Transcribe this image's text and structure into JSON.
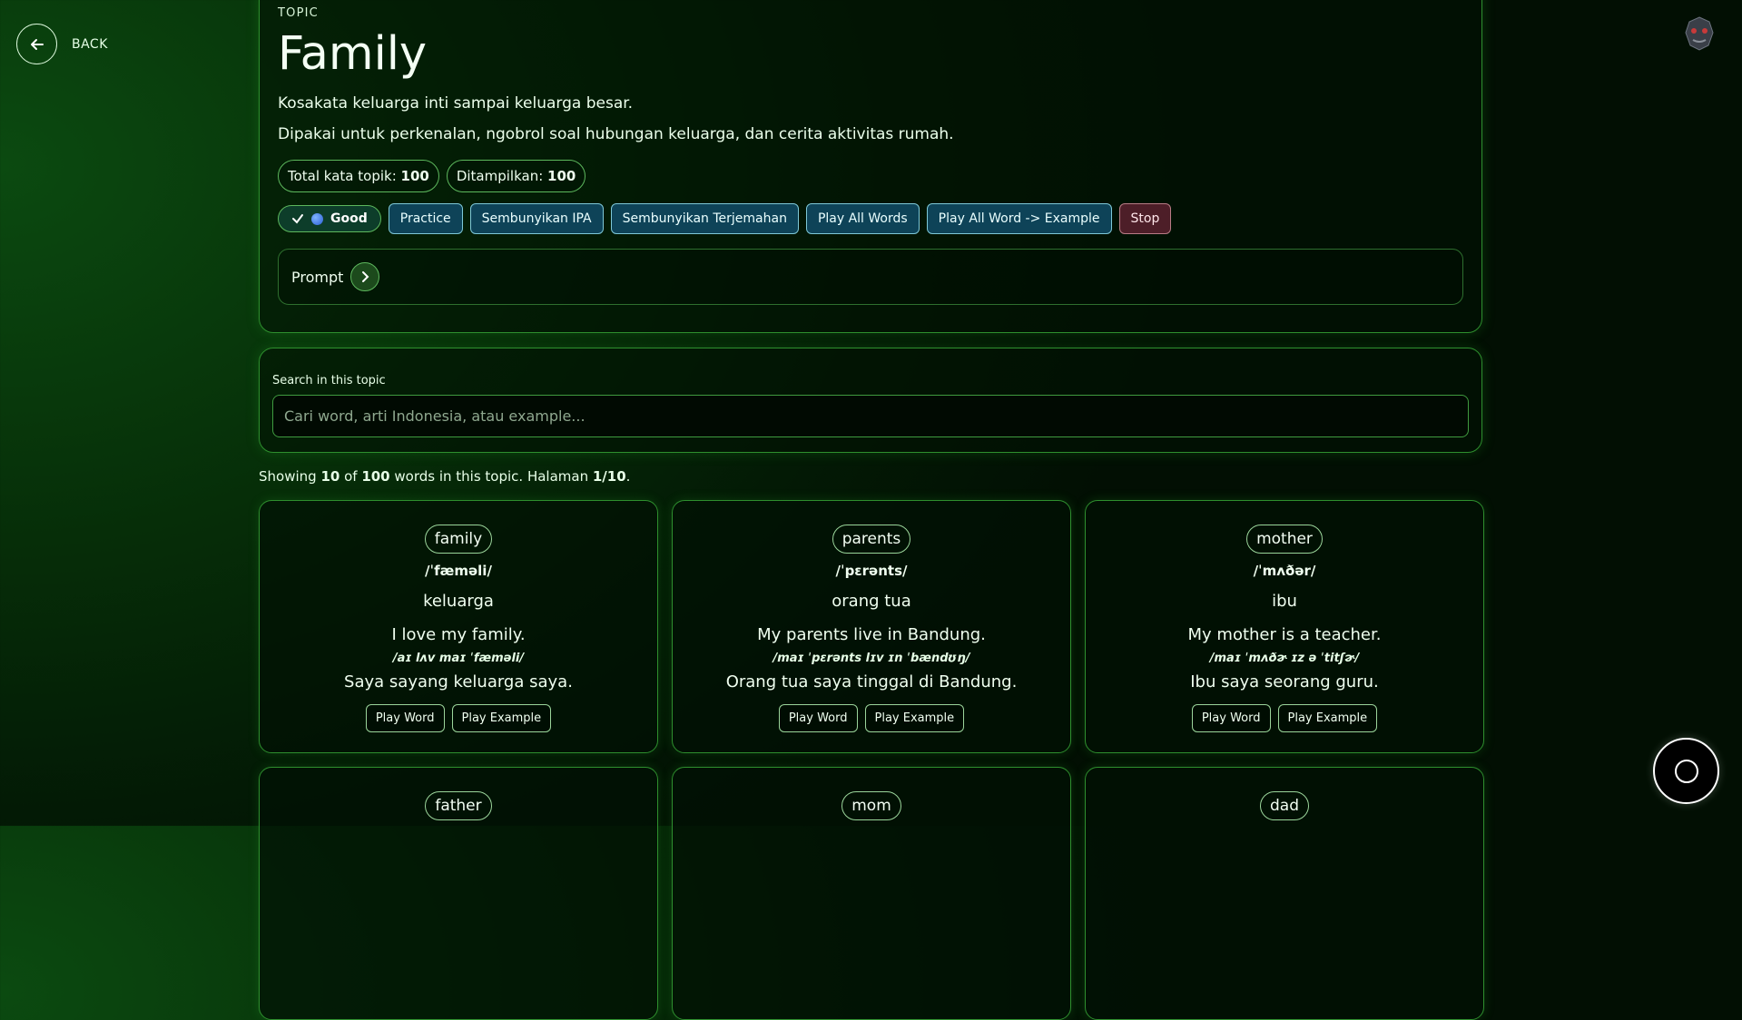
{
  "nav": {
    "back_label": "BACK"
  },
  "topic": {
    "eyebrow": "TOPIC",
    "title": "Family",
    "description_1": "Kosakata keluarga inti sampai keluarga besar.",
    "description_2": "Dipakai untuk perkenalan, ngobrol soal hubungan keluarga, dan cerita aktivitas rumah."
  },
  "stats": {
    "total_label": "Total kata topik: ",
    "total_value": "100",
    "shown_label": "Ditampilkan: ",
    "shown_value": "100"
  },
  "actions": {
    "good_label": "Good",
    "practice": "Practice",
    "hide_ipa": "Sembunyikan IPA",
    "hide_translation": "Sembunyikan Terjemahan",
    "play_all": "Play All Words",
    "play_all_example": "Play All Word -> Example",
    "stop": "Stop"
  },
  "prompt": {
    "label": "Prompt"
  },
  "search": {
    "label": "Search in this topic",
    "placeholder": "Cari word, arti Indonesia, atau example..."
  },
  "showing": {
    "prefix": "Showing ",
    "count": "10",
    "of": " of ",
    "total": "100",
    "middle": " words in this topic. Halaman ",
    "page": "1/10",
    "suffix": "."
  },
  "card_buttons": {
    "play_word": "Play Word",
    "play_example": "Play Example"
  },
  "cards": [
    {
      "word": "family",
      "ipa": "/ˈfæməli/",
      "meaning": "keluarga",
      "example": "I love my family.",
      "example_ipa": "/aɪ lʌv maɪ ˈfæməli/",
      "example_translation": "Saya sayang keluarga saya."
    },
    {
      "word": "parents",
      "ipa": "/ˈpɛrənts/",
      "meaning": "orang tua",
      "example": "My parents live in Bandung.",
      "example_ipa": "/maɪ ˈpɛrənts lɪv ɪn ˈbændʊŋ/",
      "example_translation": "Orang tua saya tinggal di Bandung."
    },
    {
      "word": "mother",
      "ipa": "/ˈmʌðər/",
      "meaning": "ibu",
      "example": "My mother is a teacher.",
      "example_ipa": "/maɪ ˈmʌðɚ ɪz ə ˈtitʃɚ/",
      "example_translation": "Ibu saya seorang guru."
    },
    {
      "word": "father"
    },
    {
      "word": "mom"
    },
    {
      "word": "dad"
    }
  ]
}
